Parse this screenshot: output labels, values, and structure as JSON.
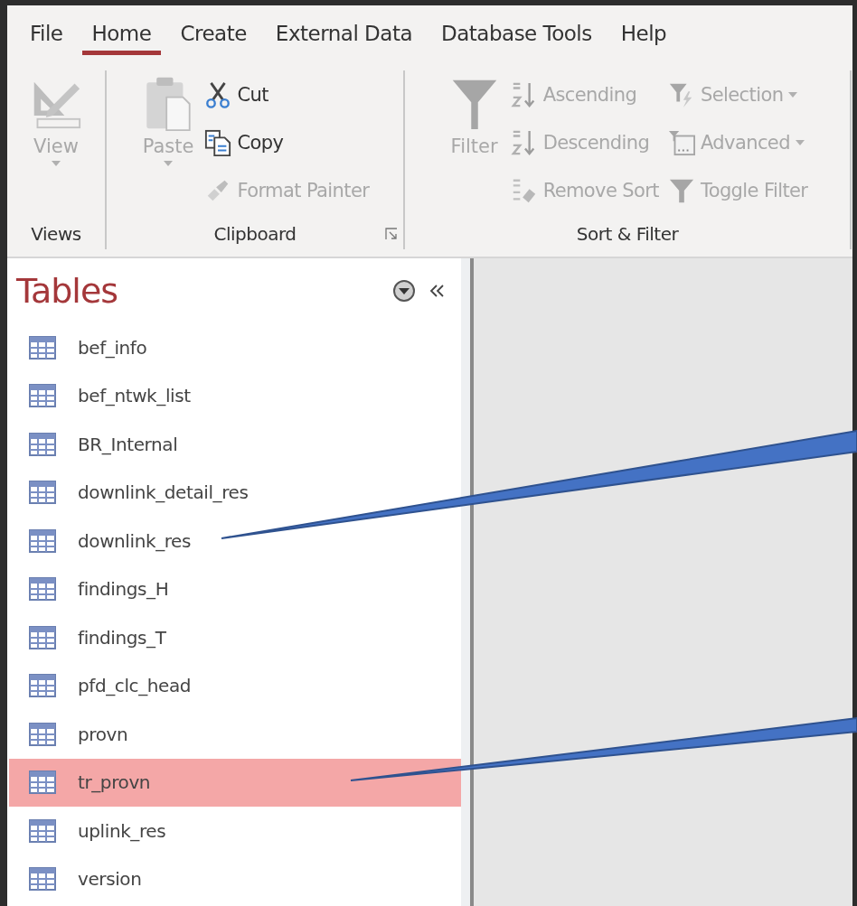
{
  "ribbon_tabs": [
    {
      "label": "File",
      "selected": false
    },
    {
      "label": "Home",
      "selected": true
    },
    {
      "label": "Create",
      "selected": false
    },
    {
      "label": "External Data",
      "selected": false
    },
    {
      "label": "Database Tools",
      "selected": false
    },
    {
      "label": "Help",
      "selected": false
    }
  ],
  "ribbon_groups": [
    {
      "label": "Views",
      "buttons": [
        {
          "kind": "large",
          "label": "View",
          "disabled": true,
          "dropdown": true
        }
      ]
    },
    {
      "label": "Clipboard",
      "dialog_launcher": true,
      "buttons": [
        {
          "kind": "large",
          "label": "Paste",
          "disabled": true,
          "dropdown": true
        },
        {
          "kind": "small",
          "label": "Cut",
          "disabled": false,
          "dropdown": false
        },
        {
          "kind": "small",
          "label": "Copy",
          "disabled": false,
          "dropdown": false
        },
        {
          "kind": "small",
          "label": "Format Painter",
          "disabled": true,
          "dropdown": false
        }
      ]
    },
    {
      "label": "Sort & Filter",
      "buttons": [
        {
          "kind": "large",
          "label": "Filter",
          "disabled": true,
          "dropdown": false
        },
        {
          "kind": "small",
          "label": "Ascending",
          "disabled": true,
          "dropdown": false
        },
        {
          "kind": "small",
          "label": "Descending",
          "disabled": true,
          "dropdown": false
        },
        {
          "kind": "small",
          "label": "Remove Sort",
          "disabled": true,
          "dropdown": false
        },
        {
          "kind": "small",
          "label": "Selection",
          "disabled": true,
          "dropdown": true
        },
        {
          "kind": "small",
          "label": "Advanced",
          "disabled": true,
          "dropdown": true
        },
        {
          "kind": "small",
          "label": "Toggle Filter",
          "disabled": true,
          "dropdown": false
        }
      ]
    }
  ],
  "nav_pane": {
    "title": "Tables",
    "items": [
      {
        "label": "bef_info",
        "selected": false
      },
      {
        "label": "bef_ntwk_list",
        "selected": false
      },
      {
        "label": "BR_Internal",
        "selected": false
      },
      {
        "label": "downlink_detail_res",
        "selected": false
      },
      {
        "label": "downlink_res",
        "selected": false
      },
      {
        "label": "findings_H",
        "selected": false
      },
      {
        "label": "findings_T",
        "selected": false
      },
      {
        "label": "pfd_clc_head",
        "selected": false
      },
      {
        "label": "provn",
        "selected": false
      },
      {
        "label": "tr_provn",
        "selected": true
      },
      {
        "label": "uplink_res",
        "selected": false
      },
      {
        "label": "version",
        "selected": false
      }
    ]
  }
}
